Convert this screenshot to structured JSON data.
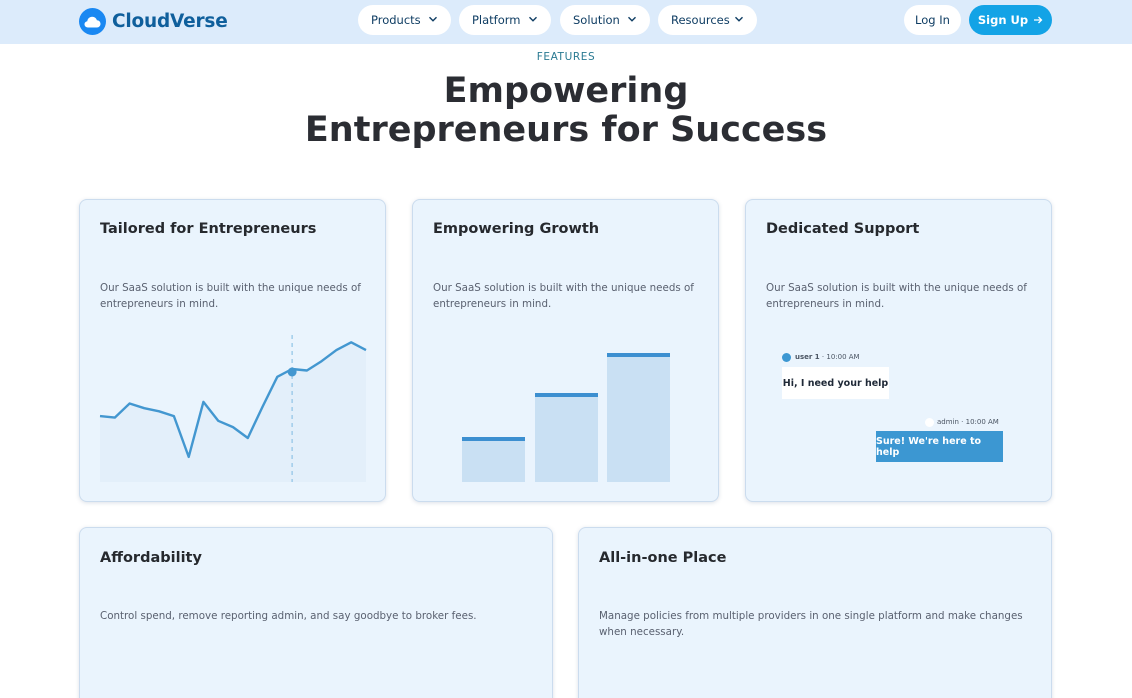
{
  "brand": {
    "name": "CloudVerse",
    "accent": "#1a88f2",
    "text_color": "#0f5f9c"
  },
  "nav": {
    "items": [
      {
        "label": "Products"
      },
      {
        "label": "Platform"
      },
      {
        "label": "Solution"
      },
      {
        "label": "Resources"
      }
    ],
    "login_label": "Log In",
    "signup_label": "Sign Up",
    "signup_color": "#13a3e6"
  },
  "hero": {
    "eyebrow": "FEATURES",
    "title_line1": "Empowering",
    "title_line2": "Entrepreneurs for Success"
  },
  "cards": {
    "tailored": {
      "title": "Tailored for Entrepreneurs",
      "description": "Our SaaS solution is built with the unique needs of entrepreneurs in mind."
    },
    "growth": {
      "title": "Empowering Growth",
      "description": "Our SaaS solution is built with the unique needs of entrepreneurs in mind."
    },
    "support": {
      "title": "Dedicated Support",
      "description": "Our SaaS solution is built with the unique needs of entrepreneurs in mind.",
      "chat": {
        "user_name": "user 1",
        "user_time": "10:00 AM",
        "user_message": "Hi, I need your help",
        "admin_name": "admin",
        "admin_time": "10:00 AM",
        "admin_message": "Sure! We're here to help"
      }
    },
    "affordability": {
      "title": "Affordability",
      "description": "Control spend, remove reporting admin, and say goodbye to broker fees."
    },
    "all_in_one": {
      "title": "All-in-one Place",
      "description": "Manage policies from multiple providers in one single platform and make changes when necessary."
    }
  },
  "chart_data": [
    {
      "type": "line",
      "series": [
        {
          "values": [
            42,
            41,
            50,
            47,
            45,
            42,
            16,
            51,
            39,
            35,
            28,
            48,
            67,
            72,
            71,
            77,
            84,
            89,
            84
          ]
        }
      ],
      "highlight_index": 13,
      "grid": false
    },
    {
      "type": "bar",
      "values": [
        45,
        89,
        129
      ]
    }
  ]
}
